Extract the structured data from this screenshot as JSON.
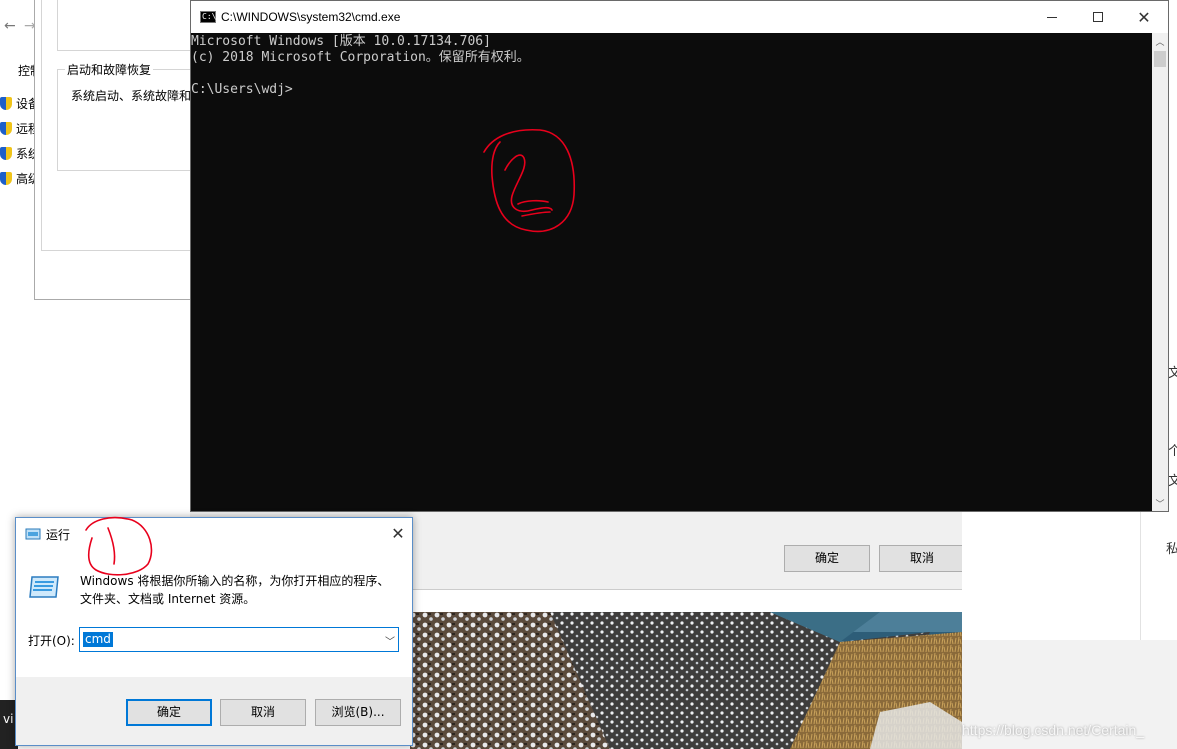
{
  "control_panel": {
    "nav_back": "←",
    "nav_forward": "→",
    "label": "控制",
    "side_items": [
      {
        "label": "设备"
      },
      {
        "label": "远程"
      },
      {
        "label": "系统"
      },
      {
        "label": "高级"
      }
    ]
  },
  "system_properties": {
    "group_title": "启动和故障恢复",
    "group_text": "系统启动、系统故障和"
  },
  "background_dialog": {
    "ok_label": "确定",
    "cancel_label": "取消"
  },
  "right_panel": {
    "chars": [
      "文",
      "个",
      "文",
      "私"
    ]
  },
  "cmd": {
    "title": "C:\\WINDOWS\\system32\\cmd.exe",
    "icon_text": "C:\\",
    "lines": [
      "Microsoft Windows [版本 10.0.17134.706]",
      "(c) 2018 Microsoft Corporation。保留所有权利。",
      "",
      "C:\\Users\\wdj>"
    ]
  },
  "run_dialog": {
    "title": "运行",
    "description": "Windows 将根据你所输入的名称，为你打开相应的程序、文件夹、文档或 Internet 资源。",
    "open_label": "打开(O):",
    "input_value": "cmd",
    "ok_label": "确定",
    "cancel_label": "取消",
    "browse_label": "浏览(B)..."
  },
  "taskbar_fragment": "vi",
  "watermark": "https://blog.csdn.net/Certain_",
  "colors": {
    "console_bg": "#0c0c0c",
    "console_text": "#cccccc",
    "accent": "#0078d7",
    "annotation": "#e8001c"
  }
}
